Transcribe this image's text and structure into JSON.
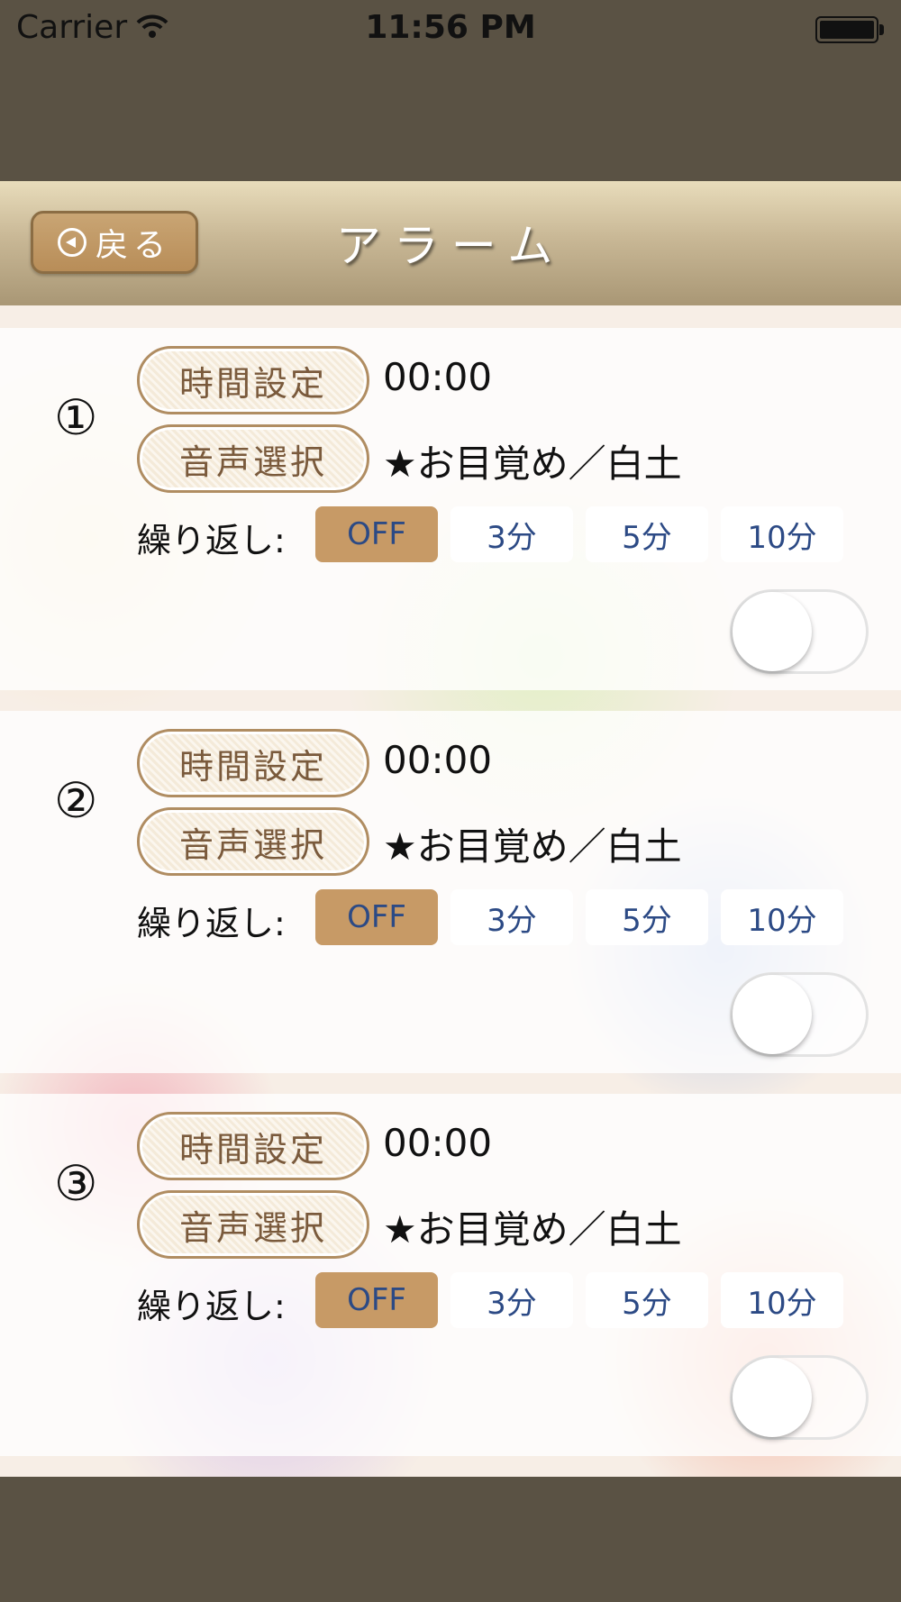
{
  "status_bar": {
    "carrier": "Carrier",
    "time": "11:56 PM",
    "icons": [
      "wifi-icon",
      "battery-icon"
    ]
  },
  "nav": {
    "back_label": "戻る",
    "title": "アラーム"
  },
  "alarms": [
    {
      "number": "①",
      "time_button": "時間設定",
      "time_value": "00:00",
      "sound_button": "音声選択",
      "sound_value": "★お目覚め／白土",
      "repeat_label": "繰り返し:",
      "repeat_options": [
        "OFF",
        "3分",
        "5分",
        "10分"
      ],
      "repeat_selected": "OFF",
      "enabled": false
    },
    {
      "number": "②",
      "time_button": "時間設定",
      "time_value": "00:00",
      "sound_button": "音声選択",
      "sound_value": "★お目覚め／白土",
      "repeat_label": "繰り返し:",
      "repeat_options": [
        "OFF",
        "3分",
        "5分",
        "10分"
      ],
      "repeat_selected": "OFF",
      "enabled": false
    },
    {
      "number": "③",
      "time_button": "時間設定",
      "time_value": "00:00",
      "sound_button": "音声選択",
      "sound_value": "★お目覚め／白土",
      "repeat_label": "繰り返し:",
      "repeat_options": [
        "OFF",
        "3分",
        "5分",
        "10分"
      ],
      "repeat_selected": "OFF",
      "enabled": false
    }
  ],
  "colors": {
    "frame": "#5a5244",
    "accent": "#c79a66",
    "segment_text": "#2c4a85"
  }
}
